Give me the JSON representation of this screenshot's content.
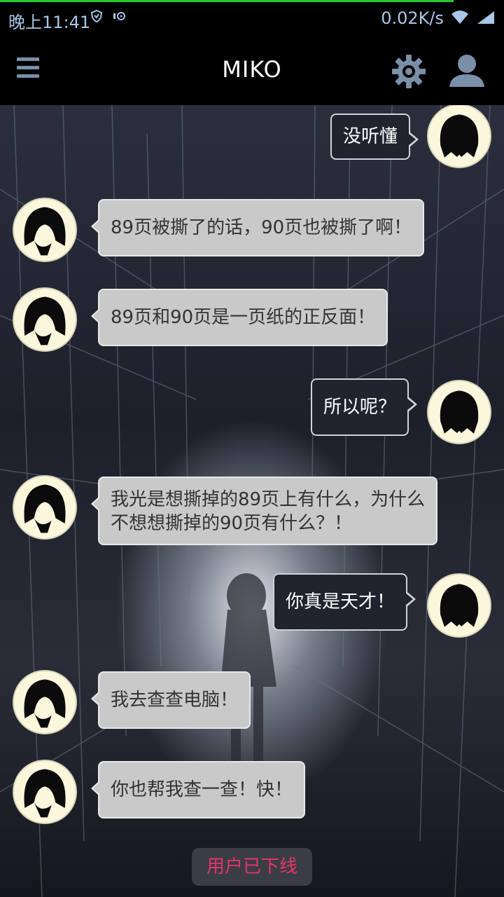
{
  "status_bar": {
    "time": "晚上11:41",
    "net_speed": "0.02K/s",
    "accent": "#28c832",
    "load_progress": 0.9
  },
  "header": {
    "title": "MIKO",
    "icons": [
      "menu-icon",
      "gear-icon",
      "user-icon"
    ]
  },
  "messages": [
    {
      "side": "right",
      "text": "没听懂"
    },
    {
      "side": "left",
      "text": "89页被撕了的话，90页也被撕了啊！"
    },
    {
      "side": "left",
      "text": "89页和90页是一页纸的正反面！"
    },
    {
      "side": "right",
      "text": "所以呢？"
    },
    {
      "side": "left",
      "text": "我光是想撕掉的89页上有什么，为什么",
      "text2": "不想想撕掉的90页有什么？！"
    },
    {
      "side": "right",
      "text": "你真是天才！"
    },
    {
      "side": "left",
      "text": "我去查查电脑！"
    },
    {
      "side": "left",
      "text": "你也帮我查一查！快！"
    }
  ],
  "footer": {
    "status": "用户已下线",
    "status_color": "#e8336b"
  }
}
